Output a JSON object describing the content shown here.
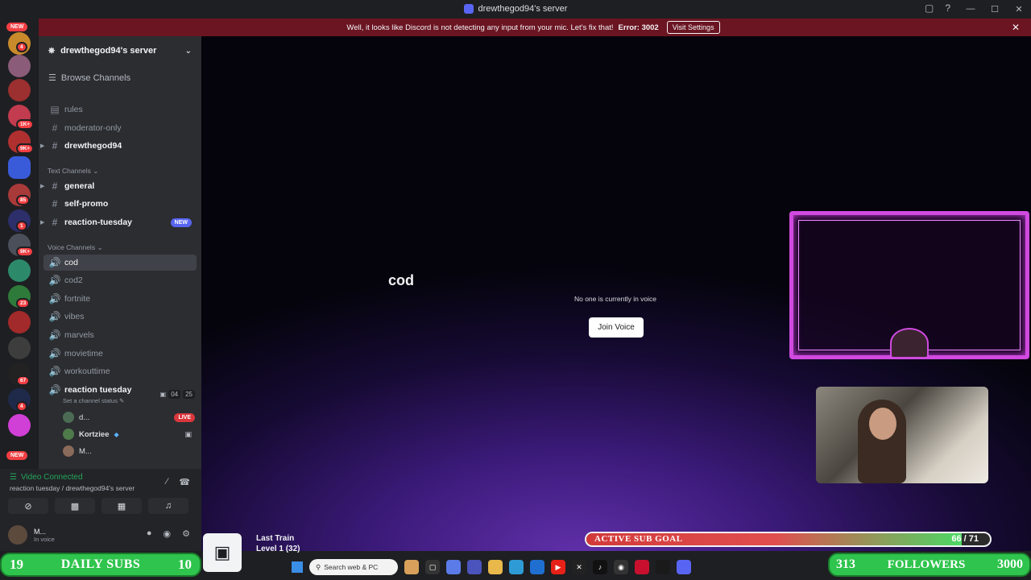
{
  "window": {
    "title": "drewthegod94's server"
  },
  "banner": {
    "message": "Well, it looks like Discord is not detecting any input from your mic. Let's fix that!",
    "error": "Error: 3002",
    "button": "Visit Settings"
  },
  "rail": {
    "badges": [
      "NEW",
      "4",
      "1K+",
      "9K+",
      "85",
      "1",
      "9K+",
      "23",
      "67",
      "4",
      "NEW"
    ]
  },
  "server": {
    "name": "drewthegod94's server",
    "browse": "Browse Channels",
    "top_channels": [
      {
        "name": "rules"
      },
      {
        "name": "moderator-only"
      },
      {
        "name": "drewthegod94"
      }
    ],
    "text_category": "Text Channels",
    "text_channels": [
      {
        "name": "general"
      },
      {
        "name": "self-promo"
      },
      {
        "name": "reaction-tuesday",
        "tag": "NEW"
      }
    ],
    "voice_category": "Voice Channels",
    "voice_channels": [
      {
        "name": "cod"
      },
      {
        "name": "cod2"
      },
      {
        "name": "fortnite"
      },
      {
        "name": "vibes"
      },
      {
        "name": "marvels"
      },
      {
        "name": "movietime"
      },
      {
        "name": "workouttime"
      },
      {
        "name": "reaction tuesday"
      }
    ],
    "reaction_meta": {
      "a": "04",
      "b": "25"
    },
    "channel_status": "Set a channel status",
    "members": [
      {
        "name": "d...",
        "badge": "LIVE"
      },
      {
        "name": "Kortziee"
      },
      {
        "name": "M..."
      }
    ]
  },
  "voice_panel": {
    "status": "Video Connected",
    "location": "reaction tuesday / drewthegod94's server"
  },
  "user": {
    "name": "M...",
    "status": "In voice"
  },
  "main": {
    "channel": "cod",
    "empty": "No one is currently in voice",
    "join": "Join Voice"
  },
  "overlay": {
    "music_title": "Last Train",
    "music_level": "Level 1  (32)",
    "goal_label": "ACTIVE SUB GOAL",
    "goal_value": "66 / 71",
    "goal_fraction": 0.93,
    "subs_left": "19",
    "subs_label": "DAILY SUBS",
    "subs_right": "10",
    "followers_left": "313",
    "followers_label": "FOLLOWERS",
    "followers_right": "3000"
  },
  "taskbar": {
    "search": "Search web & PC"
  }
}
